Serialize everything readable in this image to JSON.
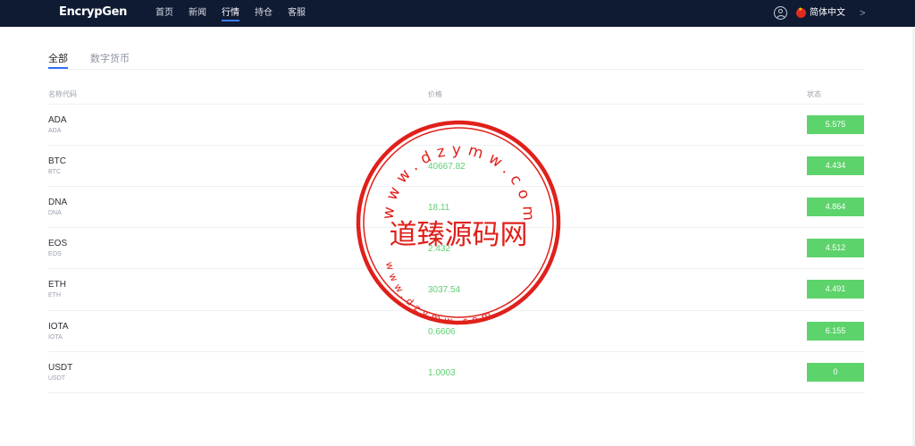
{
  "header": {
    "logo": "EncrypGen",
    "nav": [
      "首页",
      "新闻",
      "行情",
      "持仓",
      "客服"
    ],
    "active_nav": 2,
    "language": "简体中文",
    "chevron": ">"
  },
  "tabs": [
    "全部",
    "数字货币"
  ],
  "columns": {
    "name": "名称代码",
    "price": "价格",
    "status": "状态"
  },
  "rows": [
    {
      "symbol": "ADA",
      "sub": "ADA",
      "price": "",
      "status": "5.575"
    },
    {
      "symbol": "BTC",
      "sub": "BTC",
      "price": "40667.82",
      "status": "4.434"
    },
    {
      "symbol": "DNA",
      "sub": "DNA",
      "price": "18.11",
      "status": "4.864"
    },
    {
      "symbol": "EOS",
      "sub": "EOS",
      "price": "2.432",
      "status": "4.512"
    },
    {
      "symbol": "ETH",
      "sub": "ETH",
      "price": "3037.54",
      "status": "4.491"
    },
    {
      "symbol": "IOTA",
      "sub": "IOTA",
      "price": "0.6606",
      "status": "6.155"
    },
    {
      "symbol": "USDT",
      "sub": "USDT",
      "price": "1.0003",
      "status": "0"
    }
  ],
  "watermark": {
    "text": "道臻源码网",
    "url": "www.dzymw.com",
    "color": "#e0201b"
  },
  "colors": {
    "header_bg": "#0f1a33",
    "accent": "#2f6dff",
    "price": "#5fcf72",
    "badge": "#5dd36b"
  }
}
